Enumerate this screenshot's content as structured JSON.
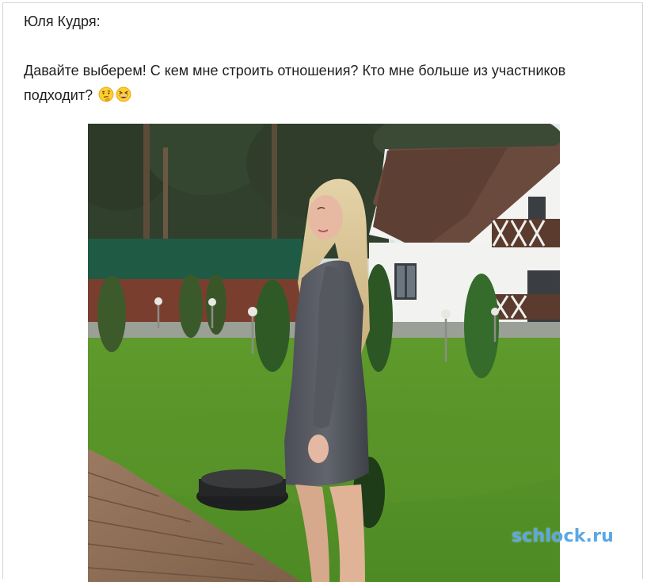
{
  "post": {
    "author": "Юля Кудря:",
    "message": "Давайте выберем! С кем мне строить отношения? Кто мне больше из участников подходит?",
    "emojis": [
      "thinking-face-icon",
      "grinning-squinting-face-icon"
    ]
  },
  "watermark": "schlock.ru"
}
